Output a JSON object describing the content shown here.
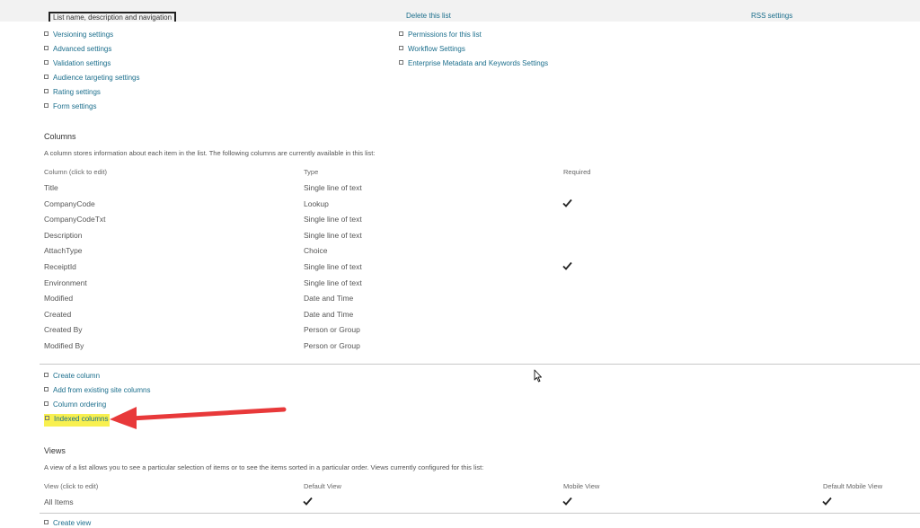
{
  "top_cut": {
    "left": "List name, description and navigation",
    "middle": "Delete this list",
    "right": "RSS settings"
  },
  "general_settings": [
    "Versioning settings",
    "Advanced settings",
    "Validation settings",
    "Audience targeting settings",
    "Rating settings",
    "Form settings"
  ],
  "permissions_settings": [
    "Permissions for this list",
    "Workflow Settings",
    "Enterprise Metadata and Keywords Settings"
  ],
  "columns": {
    "title": "Columns",
    "description": "A column stores information about each item in the list. The following columns are currently available in this list:",
    "headers": {
      "column": "Column (click to edit)",
      "type": "Type",
      "required": "Required"
    },
    "rows": [
      {
        "name": "Title",
        "type": "Single line of text",
        "required": false
      },
      {
        "name": "CompanyCode",
        "type": "Lookup",
        "required": true
      },
      {
        "name": "CompanyCodeTxt",
        "type": "Single line of text",
        "required": false
      },
      {
        "name": "Description",
        "type": "Single line of text",
        "required": false
      },
      {
        "name": "AttachType",
        "type": "Choice",
        "required": false
      },
      {
        "name": "ReceiptId",
        "type": "Single line of text",
        "required": true
      },
      {
        "name": "Environment",
        "type": "Single line of text",
        "required": false
      },
      {
        "name": "Modified",
        "type": "Date and Time",
        "required": false
      },
      {
        "name": "Created",
        "type": "Date and Time",
        "required": false
      },
      {
        "name": "Created By",
        "type": "Person or Group",
        "required": false
      },
      {
        "name": "Modified By",
        "type": "Person or Group",
        "required": false
      }
    ],
    "links": {
      "create_column": "Create column",
      "add_from_site": "Add from existing site columns",
      "column_ordering": "Column ordering",
      "indexed_columns": "Indexed columns"
    }
  },
  "views": {
    "title": "Views",
    "description": "A view of a list allows you to see a particular selection of items or to see the items sorted in a particular order. Views currently configured for this list:",
    "headers": {
      "view": "View (click to edit)",
      "default_view": "Default View",
      "mobile_view": "Mobile View",
      "default_mobile_view": "Default Mobile View"
    },
    "rows": [
      {
        "name": "All Items",
        "default_view": true,
        "mobile_view": true,
        "default_mobile_view": true
      }
    ],
    "create_view": "Create view"
  },
  "colors": {
    "link": "#1b6e8c",
    "highlight": "#f8f050",
    "arrow": "#e8393a"
  },
  "icons": {
    "check": "check-icon",
    "cursor": "mouse-cursor-icon",
    "arrow": "red-arrow-annotation"
  }
}
